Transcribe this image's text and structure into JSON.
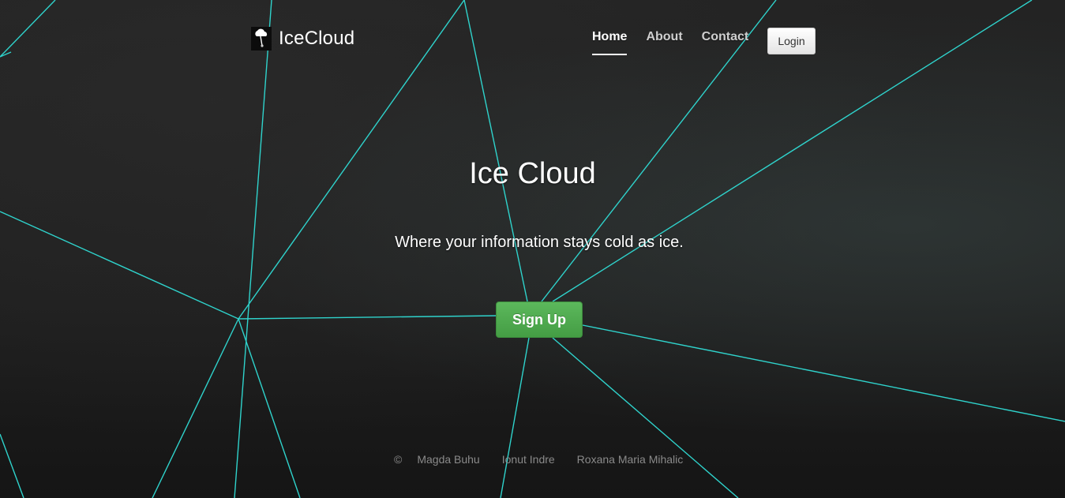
{
  "brand": {
    "name": "IceCloud",
    "logo_icon": "cloud-icecream-icon"
  },
  "nav": {
    "items": [
      {
        "label": "Home",
        "active": true
      },
      {
        "label": "About",
        "active": false
      },
      {
        "label": "Contact",
        "active": false
      }
    ],
    "login_label": "Login"
  },
  "hero": {
    "title": "Ice Cloud",
    "subtitle": "Where your information stays cold as ice.",
    "signup_label": "Sign Up"
  },
  "footer": {
    "copyright_symbol": "©",
    "authors": [
      "Magda Buhu",
      "Ionut Indre",
      "Roxana Maria Mihalic"
    ]
  },
  "colors": {
    "line_accent": "#2fd3cc",
    "signup_green": "#5cb85c",
    "background": "#1d1d1d"
  }
}
